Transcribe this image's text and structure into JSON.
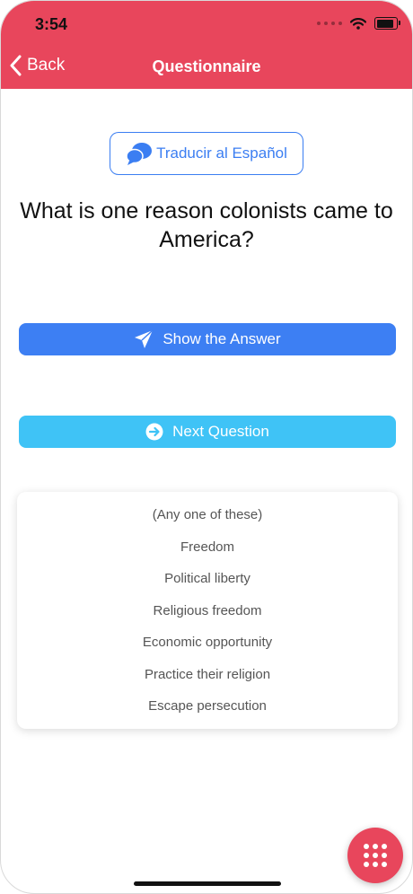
{
  "status_bar": {
    "time": "3:54"
  },
  "nav": {
    "back_label": "Back",
    "title": "Questionnaire"
  },
  "translate_button": {
    "label": "Traducir al Español",
    "icon": "chat-bubbles-icon"
  },
  "question": {
    "text": "What is one reason colonists came to America?"
  },
  "show_answer_button": {
    "label": "Show the Answer",
    "icon": "paper-plane-icon"
  },
  "next_question_button": {
    "label": "Next Question",
    "icon": "arrow-circle-right-icon"
  },
  "answers": [
    "(Any one of these)",
    "Freedom",
    "Political liberty",
    "Religious freedom",
    "Economic opportunity",
    "Practice their religion",
    "Escape persecution"
  ],
  "fab": {
    "icon": "grid-menu-icon"
  },
  "colors": {
    "header": "#e8465c",
    "primary_blue": "#3d7ff3",
    "light_blue": "#3fc3f6",
    "fab": "#e8465c"
  }
}
